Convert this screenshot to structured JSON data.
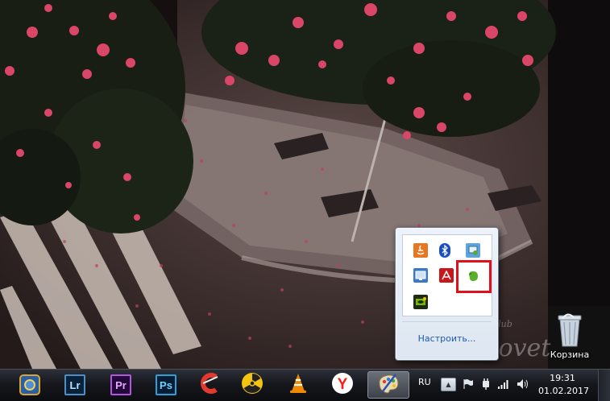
{
  "desktop": {
    "recycle_bin_label": "Корзина",
    "watermark_main": "Sovet",
    "watermark_small": "club"
  },
  "tray_popup": {
    "customize_label": "Настроить...",
    "icons": [
      "java-update-icon",
      "bluetooth-icon",
      "network-sharing-icon",
      "display-settings-icon",
      "adobe-icon",
      "evernote-icon",
      "nvidia-icon"
    ]
  },
  "taskbar": {
    "apps": [
      {
        "name": "hearthstone",
        "label": ""
      },
      {
        "name": "lightroom",
        "label": "Lr"
      },
      {
        "name": "premiere",
        "label": "Pr"
      },
      {
        "name": "photoshop",
        "label": "Ps"
      },
      {
        "name": "ccleaner",
        "label": ""
      },
      {
        "name": "fallout-shelter",
        "label": ""
      },
      {
        "name": "vlc",
        "label": ""
      },
      {
        "name": "yandex-browser",
        "label": "Y"
      },
      {
        "name": "paint",
        "label": ""
      }
    ],
    "language": "RU",
    "time": "19:31",
    "date": "01.02.2017"
  },
  "colors": {
    "highlight": "#e0101c",
    "lightroom": "#31a8ff",
    "premiere": "#e77bff",
    "photoshop": "#31c5f0",
    "yandex": "#ff1a1a"
  }
}
